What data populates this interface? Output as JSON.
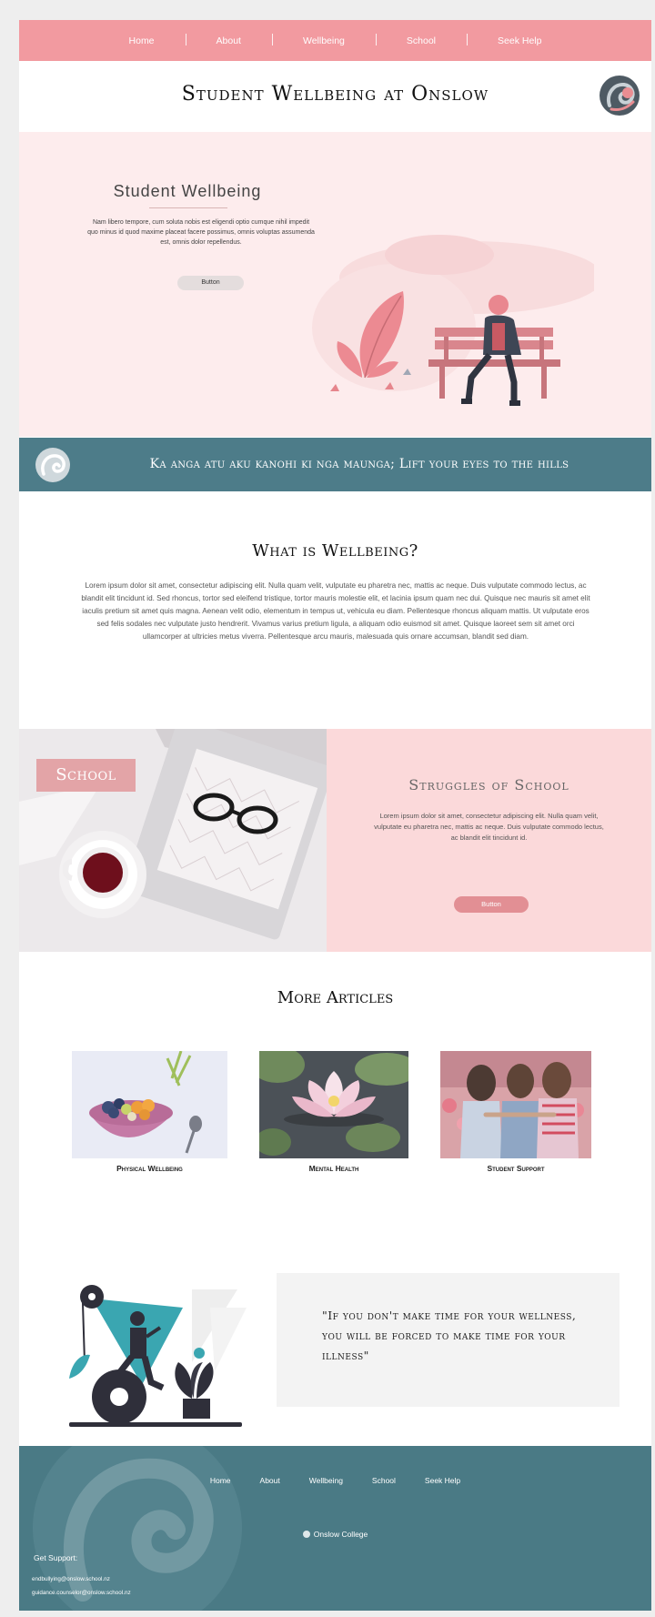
{
  "nav": {
    "items": [
      "Home",
      "About",
      "Wellbeing",
      "School",
      "Seek Help"
    ]
  },
  "site": {
    "title": "Student Wellbeing at Onslow"
  },
  "hero": {
    "title": "Student Wellbeing",
    "text": "Nam libero tempore, cum soluta nobis est eligendi optio cumque nihil impedit quo minus id quod maxime placeat facere possimus, omnis voluptas assumenda est, omnis dolor repellendus.",
    "button": "Button"
  },
  "banner": {
    "text": "Ka anga atu aku kanohi ki nga maunga; Lift your eyes to the hills"
  },
  "wellbeing": {
    "title": "What is Wellbeing?",
    "text": "Lorem ipsum dolor sit amet, consectetur adipiscing elit. Nulla quam velit, vulputate eu pharetra nec, mattis ac neque. Duis vulputate commodo lectus, ac blandit elit tincidunt id. Sed rhoncus, tortor sed eleifend tristique, tortor mauris molestie elit, et lacinia ipsum quam nec dui. Quisque nec mauris sit amet elit iaculis pretium sit amet quis magna. Aenean velit odio, elementum in tempus ut, vehicula eu diam. Pellentesque rhoncus aliquam mattis. Ut vulputate eros sed felis sodales nec vulputate justo hendrerit. Vivamus varius pretium ligula, a aliquam odio euismod sit amet. Quisque laoreet sem sit amet orci ullamcorper at ultricies metus viverra. Pellentesque arcu mauris, malesuada quis ornare accumsan, blandit sed diam."
  },
  "school": {
    "tag": "School",
    "title": "Struggles of School",
    "text": "Lorem ipsum dolor sit amet, consectetur adipiscing elit. Nulla quam velit, vulputate eu pharetra nec, mattis ac neque. Duis vulputate commodo lectus, ac blandit elit tincidunt id.",
    "button": "Button"
  },
  "articles": {
    "title": "More Articles",
    "items": [
      {
        "label": "Physical Wellbeing"
      },
      {
        "label": "Mental Health"
      },
      {
        "label": "Student Support"
      }
    ]
  },
  "quote": {
    "text": "\"If you don't make time for your wellness, you will be forced to make time for your illness\""
  },
  "footer": {
    "nav": [
      "Home",
      "About",
      "Wellbeing",
      "School",
      "Seek Help"
    ],
    "brand": "Onslow College",
    "support": "Get Support:",
    "emails": [
      "endbullying@onslow.school.nz",
      "guidance.counselor@onslow.school.nz"
    ]
  },
  "colors": {
    "nav_pink": "#f29aa0",
    "hero_bg": "#fdeced",
    "teal": "#4d7c89",
    "struggles_bg": "#fbd9da",
    "button_pink": "#e28f94"
  }
}
